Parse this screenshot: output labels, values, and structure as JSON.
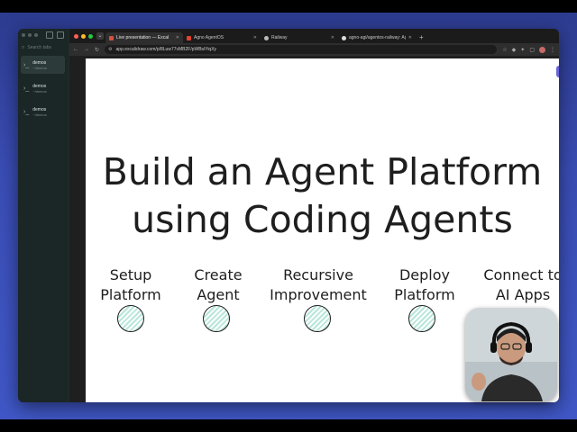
{
  "sidebar": {
    "search_placeholder": "Search tabs",
    "items": [
      {
        "title": "demos",
        "subtitle": "~/demos"
      },
      {
        "title": "demos",
        "subtitle": "~/demos"
      },
      {
        "title": "demos",
        "subtitle": "~/demos"
      }
    ]
  },
  "browser": {
    "tabs": [
      {
        "label": "Live presentation — Excal",
        "active": true,
        "favicon_color": "#d8503c"
      },
      {
        "label": "Agno AgentOS",
        "active": false,
        "favicon_color": "#e0442e"
      },
      {
        "label": "Railway",
        "active": false,
        "favicon_color": "#bbbbbb"
      },
      {
        "label": "agno-agi/agentos-railway: Ag",
        "active": false,
        "favicon_color": "#dddddd"
      }
    ],
    "url": "app.excalidraw.com/p/8Luw77vMB2F/pWBsiYiqXy"
  },
  "slide": {
    "title_line1": "Build an Agent Platform",
    "title_line2": "using Coding Agents",
    "steps": [
      {
        "label": "Setup\nPlatform"
      },
      {
        "label": "Create\nAgent"
      },
      {
        "label": "Recursive\nImprovement"
      },
      {
        "label": "Deploy\nPlatform"
      },
      {
        "label": "Connect to\nAI Apps"
      }
    ]
  },
  "colors": {
    "circle_fill": "#b8e6da",
    "library_button": "#6965db"
  }
}
